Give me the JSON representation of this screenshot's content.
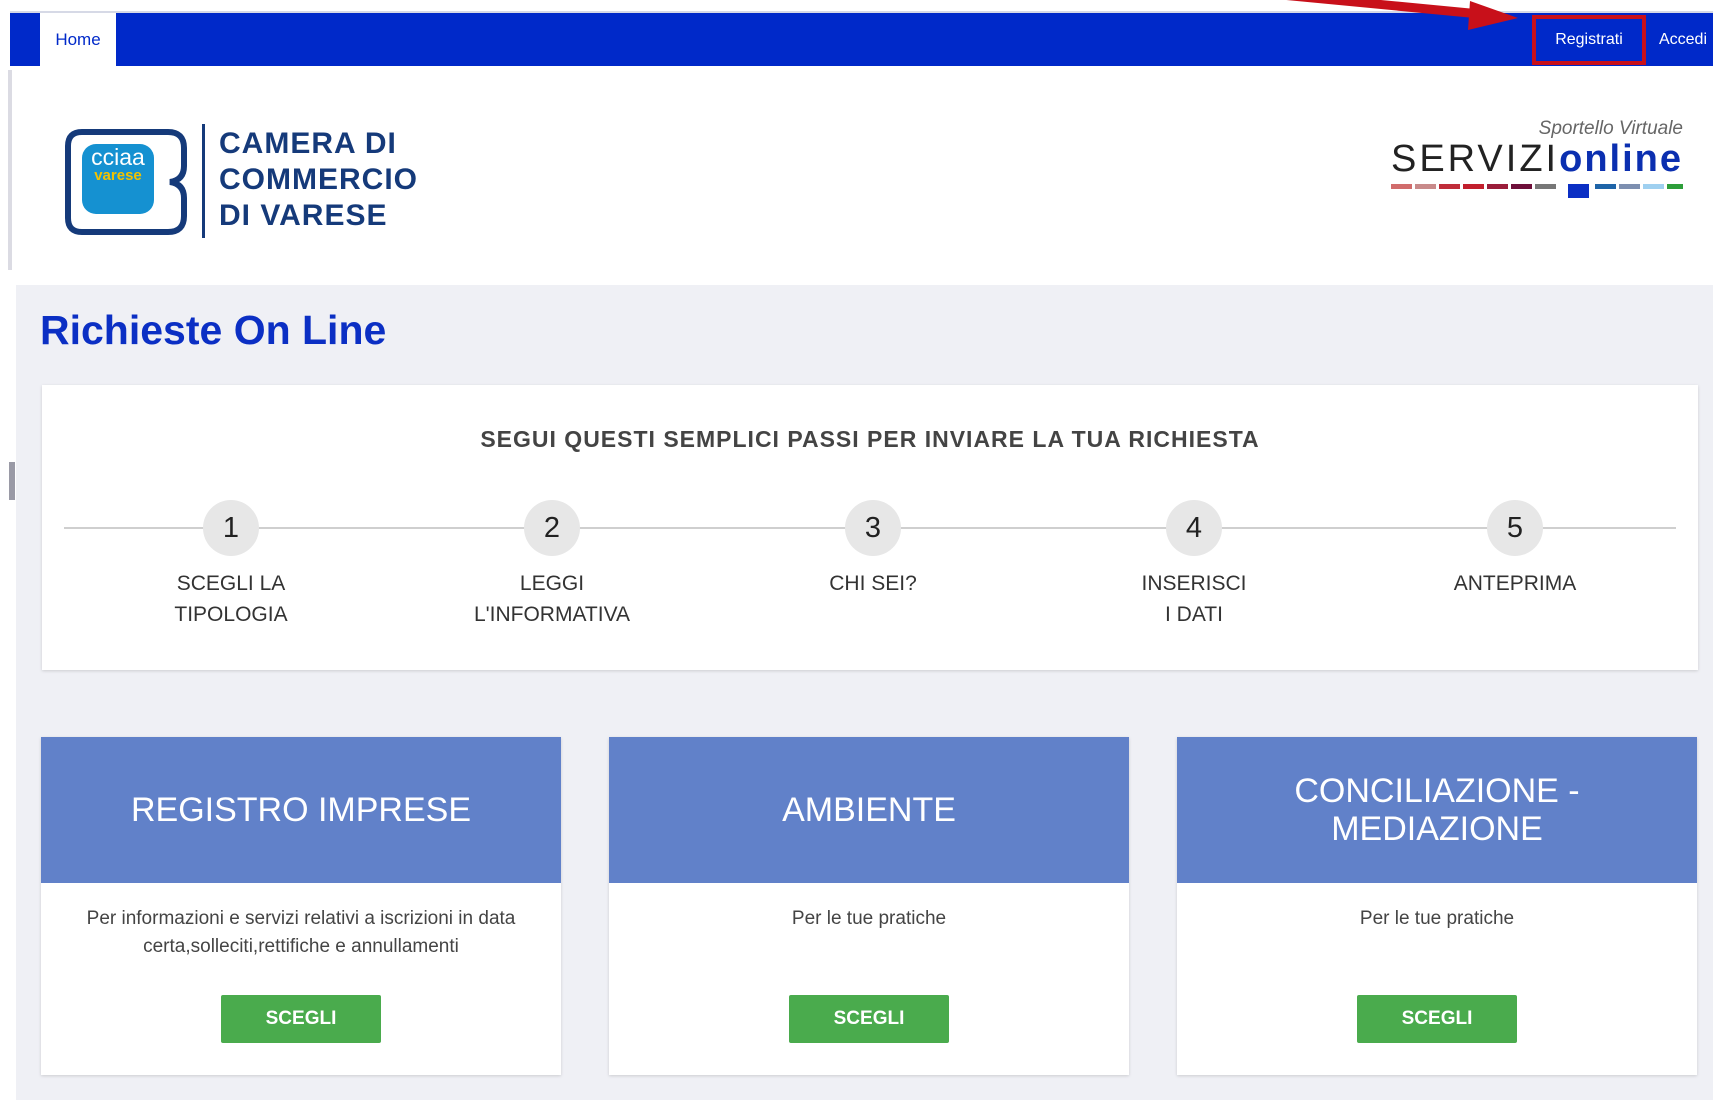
{
  "nav": {
    "home_label": "Home",
    "register_label": "Registrati",
    "login_label": "Accedi"
  },
  "header": {
    "logo_badge_top": "cciaa",
    "logo_badge_bottom": "varese",
    "logo_lines": [
      "CAMERA DI",
      "COMMERCIO",
      "DI  VARESE"
    ],
    "servizi_subtitle": "Sportello Virtuale",
    "servizi_main": "SERVIZI",
    "servizi_accent": "online"
  },
  "page_title": "Richieste On Line",
  "steps": {
    "title": "SEGUI QUESTI SEMPLICI PASSI PER INVIARE LA TUA RICHIESTA",
    "items": [
      {
        "number": "1",
        "label": "SCEGLI LA\nTIPOLOGIA"
      },
      {
        "number": "2",
        "label": "LEGGI\nL'INFORMATIVA"
      },
      {
        "number": "3",
        "label": "CHI SEI?"
      },
      {
        "number": "4",
        "label": "INSERISCI\nI DATI"
      },
      {
        "number": "5",
        "label": "ANTEPRIMA"
      }
    ]
  },
  "cards": [
    {
      "title": "REGISTRO IMPRESE",
      "description": "Per informazioni e servizi relativi a iscrizioni in data certa,solleciti,rettifiche e annullamenti",
      "button": "SCEGLI"
    },
    {
      "title": "AMBIENTE",
      "description": "Per le tue pratiche",
      "button": "SCEGLI"
    },
    {
      "title": "CONCILIAZIONE - MEDIAZIONE",
      "description": "Per le tue pratiche",
      "button": "SCEGLI"
    }
  ],
  "colors": {
    "navbar": "#0029c9",
    "title": "#0b2fc4",
    "card_header": "#6181c9",
    "button": "#4aab4d",
    "highlight": "#c8101a"
  }
}
